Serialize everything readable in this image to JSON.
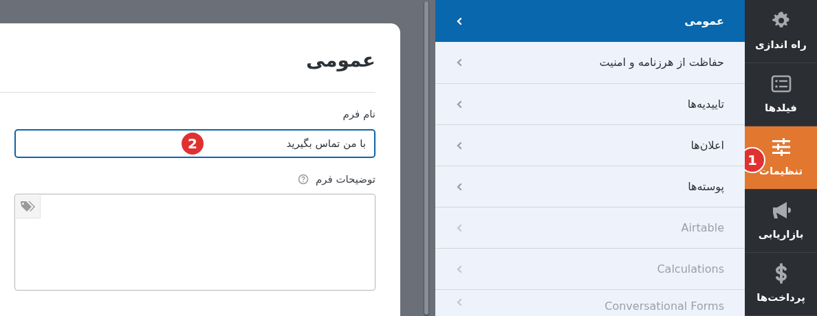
{
  "panel": {
    "title": "عمومی",
    "fields": [
      {
        "kind": "input",
        "label": "نام فرم",
        "value": "با من تماس بگیرید",
        "focused": true,
        "badge": "2"
      },
      {
        "kind": "textarea",
        "label": "توضیحات فرم",
        "help": true
      }
    ]
  },
  "settings_menu": [
    {
      "label": "عمومی",
      "selected": true,
      "disabled": false
    },
    {
      "label": "حفاظت از هرزنامه و امنیت",
      "selected": false,
      "disabled": false
    },
    {
      "label": "تاییدیه‌ها",
      "selected": false,
      "disabled": false
    },
    {
      "label": "اعلان‌ها",
      "selected": false,
      "disabled": false
    },
    {
      "label": "پوسته‌ها",
      "selected": false,
      "disabled": false
    },
    {
      "label": "Airtable",
      "selected": false,
      "disabled": true
    },
    {
      "label": "Calculations",
      "selected": false,
      "disabled": true
    },
    {
      "label": "Conversational Forms",
      "selected": false,
      "disabled": true
    }
  ],
  "sidebar": [
    {
      "label": "راه اندازی",
      "selected": false
    },
    {
      "label": "فیلدها",
      "selected": false
    },
    {
      "label": "تنظیمات",
      "selected": true,
      "badge": "1"
    },
    {
      "label": "بازاریابی",
      "selected": false
    },
    {
      "label": "پرداخت‌ها",
      "selected": false
    }
  ]
}
